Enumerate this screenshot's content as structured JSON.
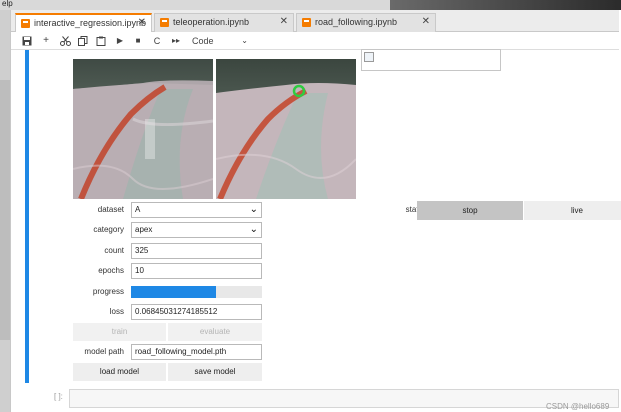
{
  "menu_fragment": "elp",
  "tabs": [
    {
      "label": "interactive_regression.ipynb",
      "active": true
    },
    {
      "label": "teleoperation.ipynb",
      "active": false
    },
    {
      "label": "road_following.ipynb",
      "active": false
    }
  ],
  "tab_close": "✕",
  "toolbar": {
    "cell_type": "Code",
    "glyph_add": "+",
    "glyph_run": "▶",
    "glyph_stop": "■",
    "glyph_restart": "C",
    "glyph_run_all": "▸▸",
    "glyph_chevron": "⌄"
  },
  "colors": {
    "accent_blue": "#1e88e5",
    "tab_orange": "#f57c00",
    "target_marker": "#2ecc40"
  },
  "form": {
    "dataset_label": "dataset",
    "dataset_value": "A",
    "category_label": "category",
    "category_value": "apex",
    "count_label": "count",
    "count_value": "325",
    "epochs_label": "epochs",
    "epochs_value": "10",
    "progress_label": "progress",
    "progress_value": 0.65,
    "loss_label": "loss",
    "loss_value": "0.06845031274185512",
    "train_label": "train",
    "evaluate_label": "evaluate",
    "model_path_label": "model path",
    "model_path_value": "road_following_model.pth",
    "load_label": "load model",
    "save_label": "save model",
    "dropdown_glyph": "⌄"
  },
  "state": {
    "label": "state",
    "stop_label": "stop",
    "live_label": "live",
    "selected": "stop"
  },
  "next_cell_prompt": "[ ]:",
  "watermark": "CSDN @hello689"
}
